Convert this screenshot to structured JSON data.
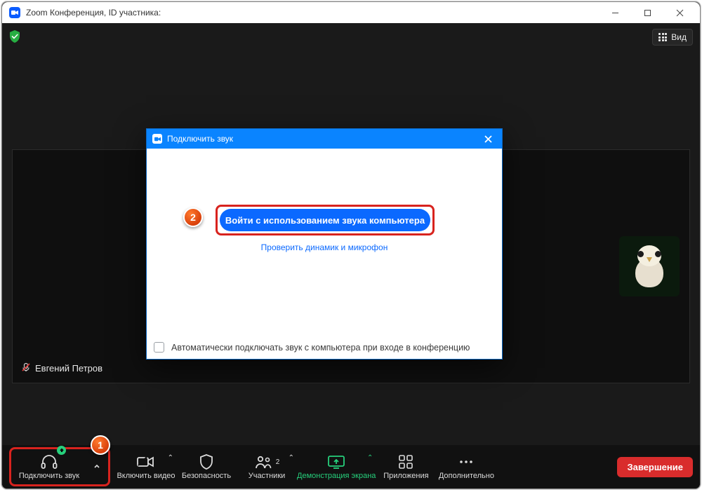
{
  "window": {
    "title": "Zoom Конференция, ID участника:"
  },
  "view_button": "Вид",
  "participant": {
    "name": "Евгений Петров"
  },
  "dialog": {
    "title": "Подключить звук",
    "primary_button": "Войти с использованием звука компьютера",
    "test_link": "Проверить динамик и микрофон",
    "auto_connect": "Автоматически подключать звук с компьютера при входе в конференцию"
  },
  "annotations": {
    "step1": "1",
    "step2": "2"
  },
  "toolbar": {
    "audio": "Подключить звук",
    "video": "Включить видео",
    "security": "Безопасность",
    "participants": "Участники",
    "participants_count": "2",
    "share": "Демонстрация экрана",
    "apps": "Приложения",
    "more": "Дополнительно",
    "end": "Завершение"
  }
}
